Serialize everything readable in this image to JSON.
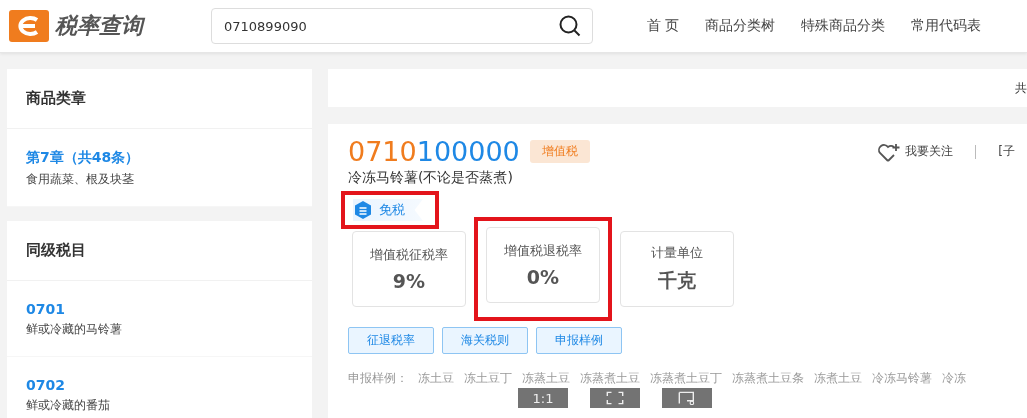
{
  "header": {
    "logo_text": "税率查询",
    "search": {
      "value": "0710899090"
    },
    "nav": [
      {
        "label": "首 页"
      },
      {
        "label": "商品分类树"
      },
      {
        "label": "特殊商品分类"
      },
      {
        "label": "常用代码表"
      }
    ]
  },
  "sidebar": [
    {
      "title": "商品类章",
      "items": [
        {
          "code": "第7章（共48条）",
          "desc": "食用蔬菜、根及块茎"
        }
      ]
    },
    {
      "title": "同级税目",
      "items": [
        {
          "code": "0701",
          "desc": "鲜或冷藏的马铃薯"
        },
        {
          "code": "0702",
          "desc": "鲜或冷藏的番茄"
        }
      ]
    }
  ],
  "summary_bar": {
    "text": "共"
  },
  "product": {
    "code_prefix": "0710",
    "code_suffix": "100000",
    "tax_tag": "增值税",
    "name": "冷冻马铃薯(不论是否蒸煮)",
    "follow": "我要关注",
    "link": "[子",
    "exempt_label": "免税",
    "stats": [
      {
        "label": "增值税征税率",
        "value": "9%",
        "highlighted": false
      },
      {
        "label": "增值税退税率",
        "value": "0%",
        "highlighted": true
      },
      {
        "label": "计量单位",
        "value": "千克",
        "highlighted": false
      }
    ],
    "exempt_highlighted": true,
    "buttons": [
      "征退税率",
      "海关税则",
      "申报样例"
    ],
    "samples_label": "申报样例：",
    "samples": [
      "冻土豆",
      "冻土豆丁",
      "冻蒸土豆",
      "冻蒸煮土豆",
      "冻蒸煮土豆丁",
      "冻蒸煮土豆条",
      "冻煮土豆",
      "冷冻马铃薯",
      "冷冻"
    ]
  },
  "viewer_toolbar": {
    "zoom_label": "1:1"
  }
}
